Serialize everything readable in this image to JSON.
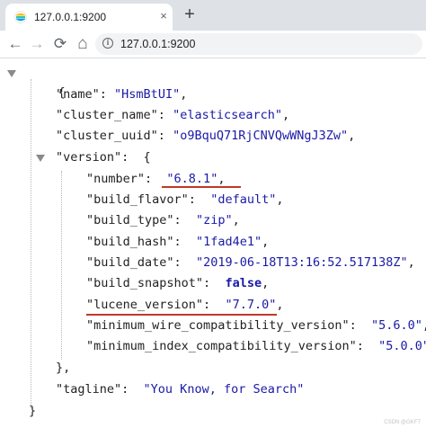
{
  "browser": {
    "tab_title": "127.0.0.1:9200",
    "tab_close": "×",
    "new_tab": "+",
    "url": "127.0.0.1:9200",
    "back": "←",
    "forward": "→",
    "reload": "⟳",
    "home": "⌂"
  },
  "json": {
    "open_brace": "{",
    "close_brace": "}",
    "name_key": "\"name\"",
    "name_val": "\"HsmBtUI\"",
    "cluster_name_key": "\"cluster_name\"",
    "cluster_name_val": "\"elasticsearch\"",
    "cluster_uuid_key": "\"cluster_uuid\"",
    "cluster_uuid_val": "\"o9BquQ71RjCNVQwWNgJ3Zw\"",
    "version_key": "\"version\"",
    "version_open": "{",
    "number_key": "\"number\"",
    "number_val": "\"6.8.1\"",
    "build_flavor_key": "\"build_flavor\"",
    "build_flavor_val": "\"default\"",
    "build_type_key": "\"build_type\"",
    "build_type_val": "\"zip\"",
    "build_hash_key": "\"build_hash\"",
    "build_hash_val": "\"1fad4e1\"",
    "build_date_key": "\"build_date\"",
    "build_date_val": "\"2019-06-18T13:16:52.517138Z\"",
    "build_snapshot_key": "\"build_snapshot\"",
    "build_snapshot_val": "false",
    "lucene_version_key": "\"lucene_version\"",
    "lucene_version_val": "\"7.7.0\"",
    "min_wire_key": "\"minimum_wire_compatibility_version\"",
    "min_wire_val": "\"5.6.0\"",
    "min_index_key": "\"minimum_index_compatibility_version\"",
    "min_index_val": "\"5.0.0\"",
    "version_close": "},",
    "tagline_key": "\"tagline\"",
    "tagline_val": "\"You Know, for Search\""
  },
  "colors": {
    "highlight_underline": "#c0392b",
    "string_value": "#1a1aa6"
  },
  "watermark": "CSDN @GKFT"
}
